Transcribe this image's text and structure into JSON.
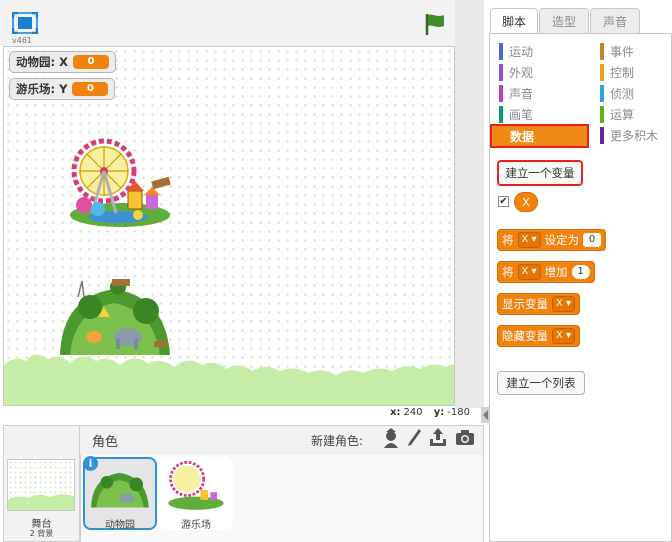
{
  "stage": {
    "version": "v461",
    "monitors": [
      {
        "label": "动物园: X",
        "value": "0"
      },
      {
        "label": "游乐场: Y",
        "value": "0"
      }
    ],
    "coords": {
      "x_label": "x:",
      "x": "240",
      "y_label": "y:",
      "y": "-180"
    }
  },
  "sprites": {
    "header": "角色",
    "new_sprite_label": "新建角色:",
    "stage_label": "舞台",
    "stage_sub": "2 背景",
    "items": [
      {
        "name": "动物园",
        "selected": true
      },
      {
        "name": "游乐场",
        "selected": false
      }
    ]
  },
  "tabs": [
    {
      "label": "脚本",
      "active": true
    },
    {
      "label": "造型",
      "active": false
    },
    {
      "label": "声音",
      "active": false
    }
  ],
  "categories": {
    "left": [
      {
        "label": "运动",
        "color": "#4a6cd4"
      },
      {
        "label": "外观",
        "color": "#8a55d7"
      },
      {
        "label": "声音",
        "color": "#bb42c3"
      },
      {
        "label": "画笔",
        "color": "#0e9a6c"
      },
      {
        "label": "数据",
        "color": "#ee7d16",
        "active": true
      }
    ],
    "right": [
      {
        "label": "事件",
        "color": "#c88330"
      },
      {
        "label": "控制",
        "color": "#e1a91a"
      },
      {
        "label": "侦测",
        "color": "#2ca5e2"
      },
      {
        "label": "运算",
        "color": "#5cb712"
      },
      {
        "label": "更多积木",
        "color": "#632d99"
      }
    ]
  },
  "blocks": {
    "make_variable": "建立一个变量",
    "var_name": "X",
    "set_prefix": "将",
    "set_var": "X",
    "set_mid": "设定为",
    "set_value": "0",
    "change_prefix": "将",
    "change_var": "X",
    "change_mid": "增加",
    "change_value": "1",
    "show_label": "显示变量",
    "show_var": "X",
    "hide_label": "隐藏变量",
    "hide_var": "X",
    "make_list": "建立一个列表"
  },
  "colors": {
    "data_orange": "#f2820f",
    "highlight_red": "#e8201f",
    "selected_blue": "#2f93d9"
  }
}
